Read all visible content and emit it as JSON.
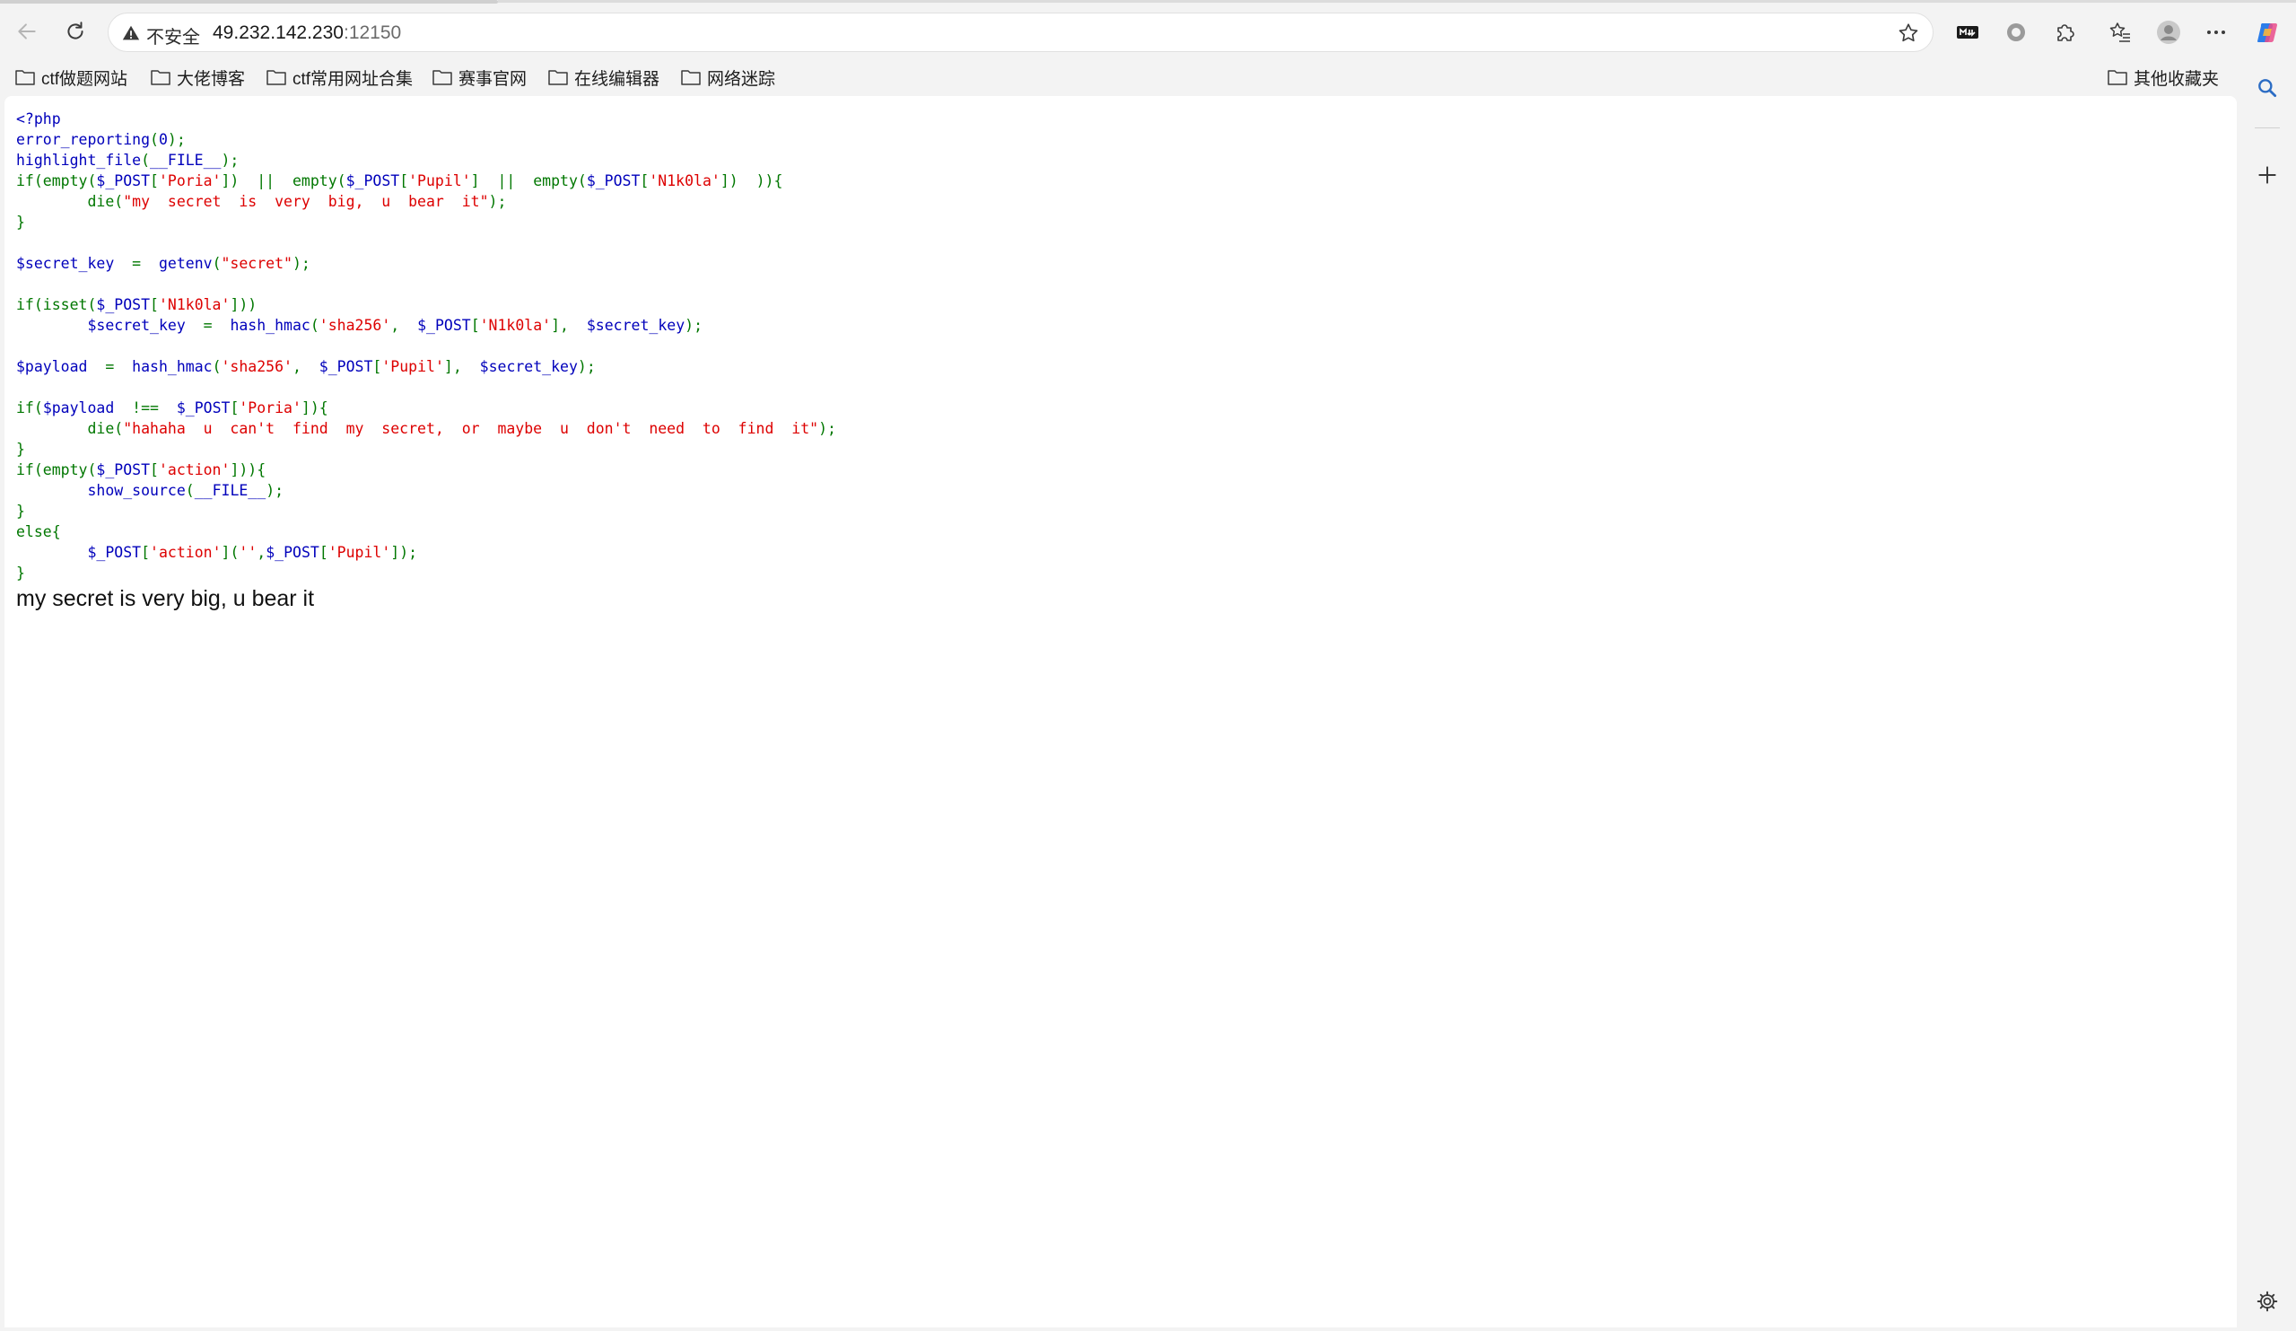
{
  "address_bar": {
    "security_label": "不安全",
    "host": "49.232.142.230",
    "port": ":12150"
  },
  "bookmarks": [
    {
      "label": "ctf做题网站"
    },
    {
      "label": "大佬博客"
    },
    {
      "label": "ctf常用网址合集"
    },
    {
      "label": "赛事官网"
    },
    {
      "label": "在线编辑器"
    },
    {
      "label": "网络迷踪"
    }
  ],
  "other_bookmarks": "其他收藏夹",
  "code_lines": [
    [
      {
        "t": "<?php",
        "c": "default"
      }
    ],
    [
      {
        "t": "error_reporting",
        "c": "default"
      },
      {
        "t": "(",
        "c": "keyword"
      },
      {
        "t": "0",
        "c": "default"
      },
      {
        "t": ");",
        "c": "keyword"
      }
    ],
    [
      {
        "t": "highlight_file",
        "c": "default"
      },
      {
        "t": "(",
        "c": "keyword"
      },
      {
        "t": "__FILE__",
        "c": "default"
      },
      {
        "t": ");",
        "c": "keyword"
      }
    ],
    [
      {
        "t": "if(empty(",
        "c": "keyword"
      },
      {
        "t": "$_POST",
        "c": "default"
      },
      {
        "t": "[",
        "c": "keyword"
      },
      {
        "t": "'Poria'",
        "c": "string"
      },
      {
        "t": "])  ||  empty(",
        "c": "keyword"
      },
      {
        "t": "$_POST",
        "c": "default"
      },
      {
        "t": "[",
        "c": "keyword"
      },
      {
        "t": "'Pupil'",
        "c": "string"
      },
      {
        "t": "]  ||  empty(",
        "c": "keyword"
      },
      {
        "t": "$_POST",
        "c": "default"
      },
      {
        "t": "[",
        "c": "keyword"
      },
      {
        "t": "'N1k0la'",
        "c": "string"
      },
      {
        "t": "])  )){",
        "c": "keyword"
      }
    ],
    [
      {
        "t": "        die(",
        "c": "keyword"
      },
      {
        "t": "\"my  secret  is  very  big,  u  bear  it\"",
        "c": "string"
      },
      {
        "t": ");",
        "c": "keyword"
      }
    ],
    [
      {
        "t": "}",
        "c": "keyword"
      }
    ],
    [
      {
        "t": "",
        "c": "default"
      }
    ],
    [
      {
        "t": "$secret_key  ",
        "c": "default"
      },
      {
        "t": "=  ",
        "c": "keyword"
      },
      {
        "t": "getenv",
        "c": "default"
      },
      {
        "t": "(",
        "c": "keyword"
      },
      {
        "t": "\"secret\"",
        "c": "string"
      },
      {
        "t": ");",
        "c": "keyword"
      }
    ],
    [
      {
        "t": "",
        "c": "default"
      }
    ],
    [
      {
        "t": "if(isset(",
        "c": "keyword"
      },
      {
        "t": "$_POST",
        "c": "default"
      },
      {
        "t": "[",
        "c": "keyword"
      },
      {
        "t": "'N1k0la'",
        "c": "string"
      },
      {
        "t": "]))",
        "c": "keyword"
      }
    ],
    [
      {
        "t": "        ",
        "c": "default"
      },
      {
        "t": "$secret_key  ",
        "c": "default"
      },
      {
        "t": "=  ",
        "c": "keyword"
      },
      {
        "t": "hash_hmac",
        "c": "default"
      },
      {
        "t": "(",
        "c": "keyword"
      },
      {
        "t": "'sha256'",
        "c": "string"
      },
      {
        "t": ",  ",
        "c": "keyword"
      },
      {
        "t": "$_POST",
        "c": "default"
      },
      {
        "t": "[",
        "c": "keyword"
      },
      {
        "t": "'N1k0la'",
        "c": "string"
      },
      {
        "t": "],  ",
        "c": "keyword"
      },
      {
        "t": "$secret_key",
        "c": "default"
      },
      {
        "t": ");",
        "c": "keyword"
      }
    ],
    [
      {
        "t": "",
        "c": "default"
      }
    ],
    [
      {
        "t": "$payload  ",
        "c": "default"
      },
      {
        "t": "=  ",
        "c": "keyword"
      },
      {
        "t": "hash_hmac",
        "c": "default"
      },
      {
        "t": "(",
        "c": "keyword"
      },
      {
        "t": "'sha256'",
        "c": "string"
      },
      {
        "t": ",  ",
        "c": "keyword"
      },
      {
        "t": "$_POST",
        "c": "default"
      },
      {
        "t": "[",
        "c": "keyword"
      },
      {
        "t": "'Pupil'",
        "c": "string"
      },
      {
        "t": "],  ",
        "c": "keyword"
      },
      {
        "t": "$secret_key",
        "c": "default"
      },
      {
        "t": ");",
        "c": "keyword"
      }
    ],
    [
      {
        "t": "",
        "c": "default"
      }
    ],
    [
      {
        "t": "if(",
        "c": "keyword"
      },
      {
        "t": "$payload  ",
        "c": "default"
      },
      {
        "t": "!==  ",
        "c": "keyword"
      },
      {
        "t": "$_POST",
        "c": "default"
      },
      {
        "t": "[",
        "c": "keyword"
      },
      {
        "t": "'Poria'",
        "c": "string"
      },
      {
        "t": "]){",
        "c": "keyword"
      }
    ],
    [
      {
        "t": "        die(",
        "c": "keyword"
      },
      {
        "t": "\"hahaha  u  can't  find  my  secret,  or  maybe  u  don't  need  to  find  it\"",
        "c": "string"
      },
      {
        "t": ");",
        "c": "keyword"
      }
    ],
    [
      {
        "t": "}",
        "c": "keyword"
      }
    ],
    [
      {
        "t": "if(empty(",
        "c": "keyword"
      },
      {
        "t": "$_POST",
        "c": "default"
      },
      {
        "t": "[",
        "c": "keyword"
      },
      {
        "t": "'action'",
        "c": "string"
      },
      {
        "t": "])){",
        "c": "keyword"
      }
    ],
    [
      {
        "t": "        ",
        "c": "default"
      },
      {
        "t": "show_source",
        "c": "default"
      },
      {
        "t": "(",
        "c": "keyword"
      },
      {
        "t": "__FILE__",
        "c": "default"
      },
      {
        "t": ");",
        "c": "keyword"
      }
    ],
    [
      {
        "t": "}",
        "c": "keyword"
      }
    ],
    [
      {
        "t": "else{",
        "c": "keyword"
      }
    ],
    [
      {
        "t": "        ",
        "c": "default"
      },
      {
        "t": "$_POST",
        "c": "default"
      },
      {
        "t": "[",
        "c": "keyword"
      },
      {
        "t": "'action'",
        "c": "string"
      },
      {
        "t": "](",
        "c": "keyword"
      },
      {
        "t": "''",
        "c": "string"
      },
      {
        "t": ",",
        "c": "keyword"
      },
      {
        "t": "$_POST",
        "c": "default"
      },
      {
        "t": "[",
        "c": "keyword"
      },
      {
        "t": "'Pupil'",
        "c": "string"
      },
      {
        "t": "]);",
        "c": "keyword"
      }
    ],
    [
      {
        "t": "}",
        "c": "keyword"
      }
    ]
  ],
  "output_text": "my secret is very big, u bear it"
}
